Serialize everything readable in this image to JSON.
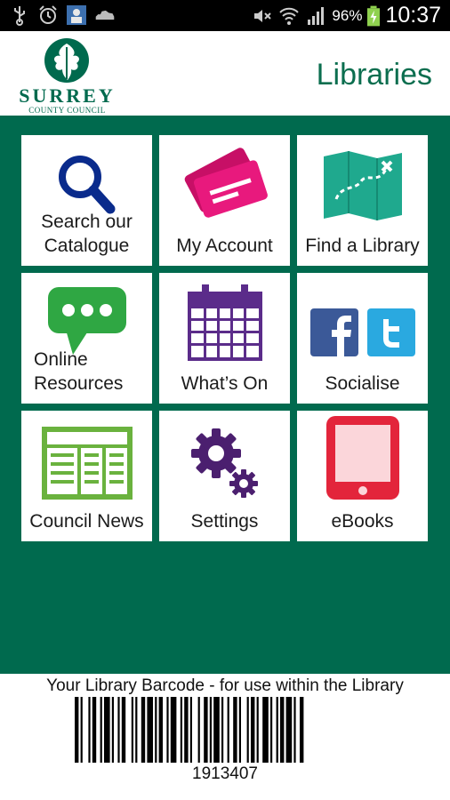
{
  "status_bar": {
    "left_icons": [
      "usb-icon",
      "alarm-icon",
      "app-notification-icon",
      "cloud-icon"
    ],
    "right_icons": [
      "mute-icon",
      "wifi-icon",
      "signal-icon",
      "battery-icon"
    ],
    "battery_percent": "96%",
    "time": "10:37"
  },
  "header": {
    "logo_name": "SURREY",
    "logo_subtitle": "COUNTY COUNCIL",
    "title": "Libraries"
  },
  "menu": {
    "items": [
      {
        "label": "Search our Catalogue",
        "icon": "search-icon",
        "color": "#0a2b8c"
      },
      {
        "label": "My Account",
        "icon": "cards-icon",
        "color": "#e3157a"
      },
      {
        "label": "Find a Library",
        "icon": "map-icon",
        "color": "#1fa98e"
      },
      {
        "label": "Online Resources",
        "icon": "chat-bubble-icon",
        "color": "#2fa743"
      },
      {
        "label": "What’s On",
        "icon": "calendar-icon",
        "color": "#5b2c8a"
      },
      {
        "label": "Socialise",
        "icon": "social-icons",
        "color": "#3b5998"
      },
      {
        "label": "Council News",
        "icon": "newspaper-icon",
        "color": "#6ab23e"
      },
      {
        "label": "Settings",
        "icon": "gears-icon",
        "color": "#4b1f6f"
      },
      {
        "label": "eBooks",
        "icon": "tablet-icon",
        "color": "#e3253b"
      }
    ]
  },
  "barcode": {
    "caption": "Your Library Barcode - for use within the Library",
    "number": "1913407"
  },
  "colors": {
    "brand_green": "#006a4e",
    "header_title": "#0b6e4f"
  }
}
